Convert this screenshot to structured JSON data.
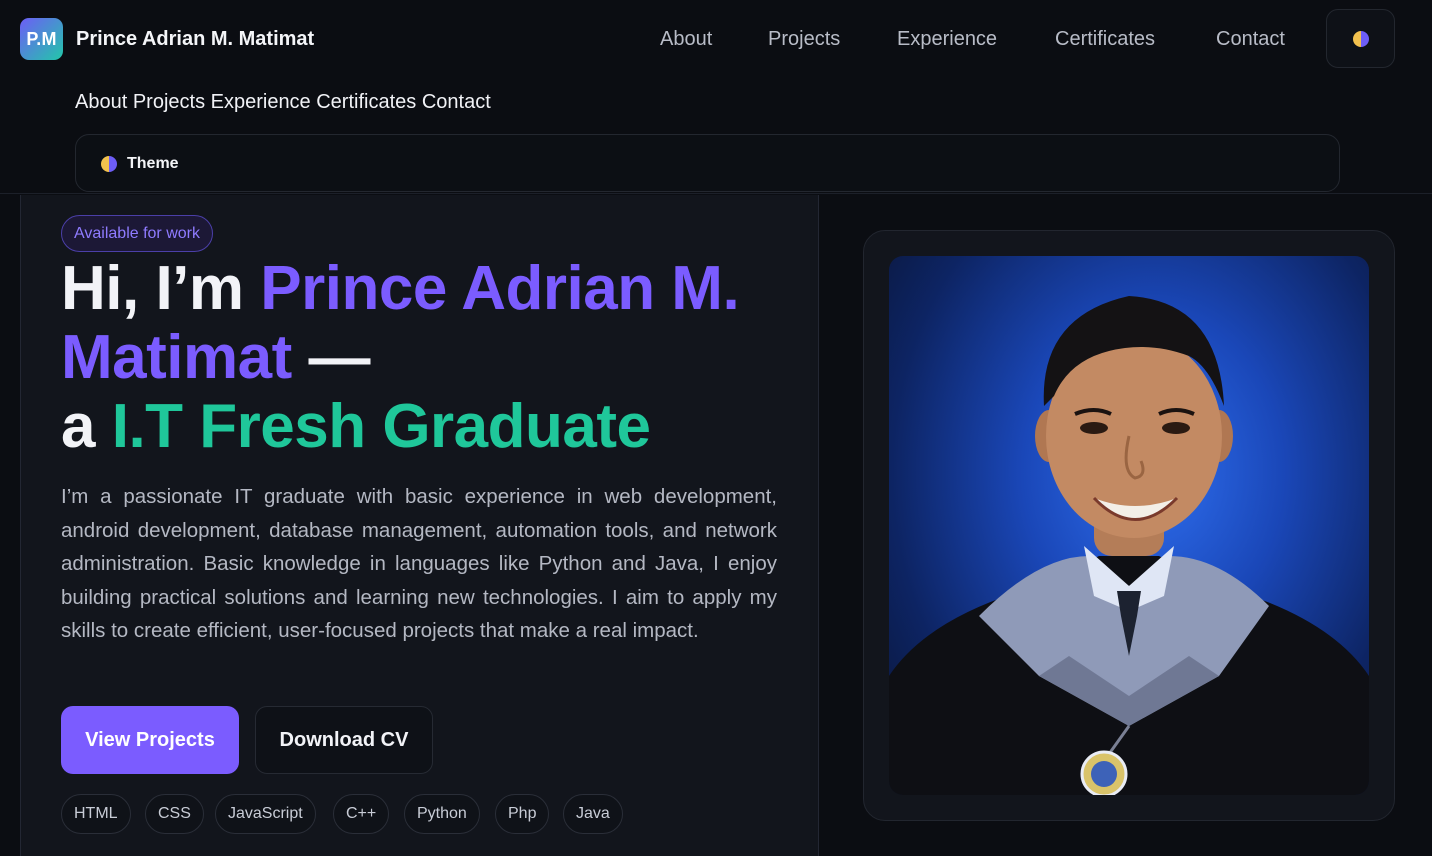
{
  "header": {
    "logo_text": "P.M",
    "brand_name": "Prince Adrian M. Matimat",
    "nav": [
      "About",
      "Projects",
      "Experience",
      "Certificates",
      "Contact"
    ],
    "mobile_links": "About Projects Experience Certificates Contact",
    "theme_label": "Theme"
  },
  "hero": {
    "badge": "Available for work",
    "greeting": "Hi, I’m ",
    "name_part1": "Prince Adrian M.",
    "name_part2": "Matimat",
    "dash": " —",
    "article": "a ",
    "role": "I.T Fresh Graduate",
    "description": "I’m a passionate IT graduate with basic experience in web development, android development, database management, automation tools, and network administration. Basic knowledge in languages like Python and Java, I enjoy building practical solutions and learning new technologies. I aim to apply my skills to create efficient, user-focused projects that make a real impact.",
    "primary_button": "View Projects",
    "secondary_button": "Download CV",
    "skills": [
      "HTML",
      "CSS",
      "JavaScript",
      "C++",
      "Python",
      "Php",
      "Java"
    ]
  },
  "colors": {
    "background": "#0b0d12",
    "accent_purple": "#7b5cff",
    "accent_green": "#1fc79a"
  }
}
